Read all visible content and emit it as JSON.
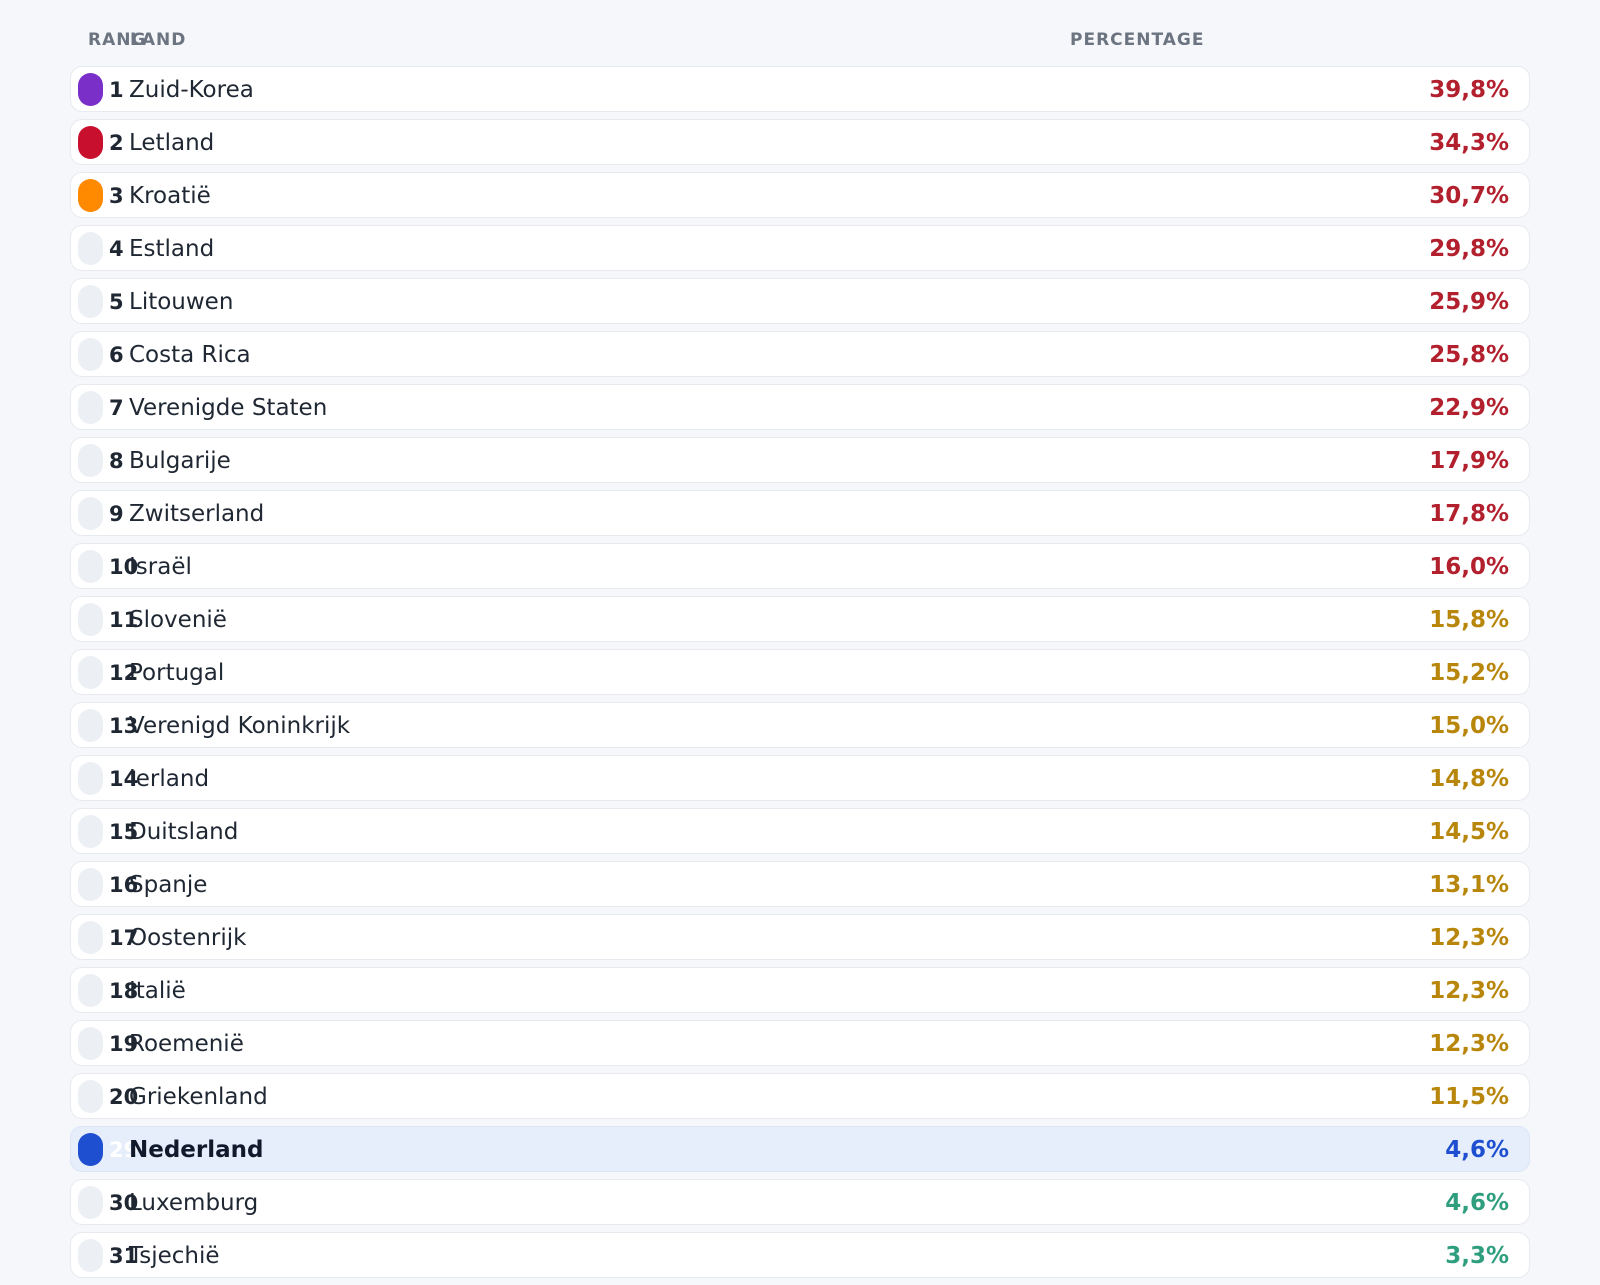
{
  "header": {
    "rank": "RANG",
    "country": "LAND",
    "percentage": "PERCENTAGE"
  },
  "colors": {
    "high": "#b21f2d",
    "medium": "#b8860b",
    "low": "#2e9e7e",
    "highlight": "#1f4fd1",
    "gold": "#7b2fc9",
    "red": "#c8102e",
    "orange": "#ff8a00",
    "neutral": "#eceff4"
  },
  "rows": [
    {
      "rank": "1",
      "country": "Zuid-Korea",
      "percentage": "39,8%",
      "level": "high",
      "badge": "gold",
      "badge_color": "#7b2fc9"
    },
    {
      "rank": "2",
      "country": "Letland",
      "percentage": "34,3%",
      "level": "high",
      "badge": "red",
      "badge_color": "#c8102e"
    },
    {
      "rank": "3",
      "country": "Kroatië",
      "percentage": "30,7%",
      "level": "high",
      "badge": "orange",
      "badge_color": "#ff8a00"
    },
    {
      "rank": "4",
      "country": "Estland",
      "percentage": "29,8%",
      "level": "high",
      "badge": "neutral"
    },
    {
      "rank": "5",
      "country": "Litouwen",
      "percentage": "25,9%",
      "level": "high",
      "badge": "neutral"
    },
    {
      "rank": "6",
      "country": "Costa Rica",
      "percentage": "25,8%",
      "level": "high",
      "badge": "neutral"
    },
    {
      "rank": "7",
      "country": "Verenigde Staten",
      "percentage": "22,9%",
      "level": "high",
      "badge": "neutral"
    },
    {
      "rank": "8",
      "country": "Bulgarije",
      "percentage": "17,9%",
      "level": "high",
      "badge": "neutral"
    },
    {
      "rank": "9",
      "country": "Zwitserland",
      "percentage": "17,8%",
      "level": "high",
      "badge": "neutral"
    },
    {
      "rank": "10",
      "country": "Israël",
      "percentage": "16,0%",
      "level": "high",
      "badge": "neutral"
    },
    {
      "rank": "11",
      "country": "Slovenië",
      "percentage": "15,8%",
      "level": "medium",
      "badge": "neutral"
    },
    {
      "rank": "12",
      "country": "Portugal",
      "percentage": "15,2%",
      "level": "medium",
      "badge": "neutral"
    },
    {
      "rank": "13",
      "country": "Verenigd Koninkrijk",
      "percentage": "15,0%",
      "level": "medium",
      "badge": "neutral"
    },
    {
      "rank": "14",
      "country": "Ierland",
      "percentage": "14,8%",
      "level": "medium",
      "badge": "neutral"
    },
    {
      "rank": "15",
      "country": "Duitsland",
      "percentage": "14,5%",
      "level": "medium",
      "badge": "neutral"
    },
    {
      "rank": "16",
      "country": "Spanje",
      "percentage": "13,1%",
      "level": "medium",
      "badge": "neutral"
    },
    {
      "rank": "17",
      "country": "Oostenrijk",
      "percentage": "12,3%",
      "level": "medium",
      "badge": "neutral"
    },
    {
      "rank": "18",
      "country": "Italië",
      "percentage": "12,3%",
      "level": "medium",
      "badge": "neutral"
    },
    {
      "rank": "19",
      "country": "Roemenië",
      "percentage": "12,3%",
      "level": "medium",
      "badge": "neutral"
    },
    {
      "rank": "20",
      "country": "Griekenland",
      "percentage": "11,5%",
      "level": "medium",
      "badge": "neutral"
    },
    {
      "rank": "29",
      "country": "Nederland",
      "percentage": "4,6%",
      "level": "highlight",
      "badge": "highlight",
      "badge_color": "#1f4fd1",
      "highlight": true
    },
    {
      "rank": "30",
      "country": "Luxemburg",
      "percentage": "4,6%",
      "level": "low",
      "badge": "neutral"
    },
    {
      "rank": "31",
      "country": "Tsjechië",
      "percentage": "3,3%",
      "level": "low",
      "badge": "neutral"
    }
  ]
}
